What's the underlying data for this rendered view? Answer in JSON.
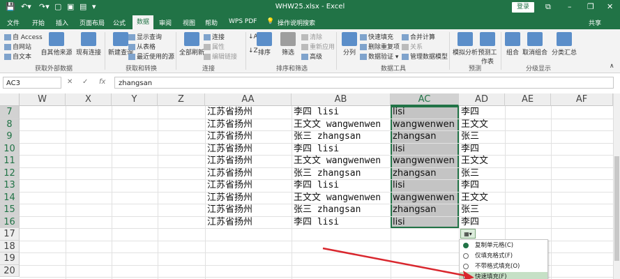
{
  "titlebar": {
    "filename": "WHW25.xlsx  -  Excel",
    "login": "登录",
    "min": "–",
    "restore": "❐",
    "close": "✕",
    "ribbon_display": "⧉"
  },
  "menu": {
    "tabs": [
      "文件",
      "开始",
      "插入",
      "页面布局",
      "公式",
      "数据",
      "审阅",
      "视图",
      "帮助",
      "WPS PDF",
      "操作说明搜索"
    ],
    "share": "共享",
    "active": "数据"
  },
  "ribbon": {
    "get_external": {
      "from_access": "自 Access",
      "from_web": "自网站",
      "from_text": "自文本",
      "from_other": "自其他来源",
      "existing": "现有连接",
      "group": "获取外部数据"
    },
    "get_transform": {
      "new_query": "新建查询",
      "show_queries": "显示查询",
      "from_table": "从表格",
      "recent_sources": "最近使用的源",
      "group": "获取和转换"
    },
    "connections": {
      "refresh_all": "全部刷新",
      "connections": "连接",
      "properties": "属性",
      "edit_links": "编辑链接",
      "group": "连接"
    },
    "sort_filter": {
      "sort": "排序",
      "filter": "筛选",
      "clear": "清除",
      "reapply": "重新应用",
      "advanced": "高级",
      "group": "排序和筛选"
    },
    "data_tools": {
      "text_to_columns": "分列",
      "flash_fill": "快速填充",
      "remove_duplicates": "删除重复项",
      "data_validation": "数据验证",
      "consolidate": "合并计算",
      "relationships": "关系",
      "manage_model": "管理数据模型",
      "group": "数据工具"
    },
    "forecast": {
      "what_if": "模拟分析",
      "forecast_sheet": "预测工作表",
      "group": "预测"
    },
    "outline": {
      "group_btn": "组合",
      "ungroup": "取消组合",
      "subtotal": "分类汇总",
      "group": "分级显示"
    }
  },
  "formula_bar": {
    "name_box": "AC3",
    "cancel": "✕",
    "enter": "✓",
    "fx": "fx",
    "value": "zhangsan"
  },
  "columns": [
    "W",
    "X",
    "Y",
    "Z",
    "AA",
    "AB",
    "AC",
    "AD",
    "AE",
    "AF"
  ],
  "selected_column": "AC",
  "rows": [
    {
      "num": "7",
      "aa": "江苏省扬州",
      "ab": "李四 lisi",
      "ac": "lisi",
      "ad": "李四"
    },
    {
      "num": "8",
      "aa": "江苏省扬州",
      "ab": "王文文 wangwenwen",
      "ac": "wangwenwen",
      "ad": "王文文"
    },
    {
      "num": "9",
      "aa": "江苏省扬州",
      "ab": "张三 zhangsan",
      "ac": "zhangsan",
      "ad": "张三"
    },
    {
      "num": "10",
      "aa": "江苏省扬州",
      "ab": "李四 lisi",
      "ac": "lisi",
      "ad": "李四"
    },
    {
      "num": "11",
      "aa": "江苏省扬州",
      "ab": "王文文 wangwenwen",
      "ac": "wangwenwen",
      "ad": "王文文"
    },
    {
      "num": "12",
      "aa": "江苏省扬州",
      "ab": "张三 zhangsan",
      "ac": "zhangsan",
      "ad": "张三"
    },
    {
      "num": "13",
      "aa": "江苏省扬州",
      "ab": "李四 lisi",
      "ac": "lisi",
      "ad": "李四"
    },
    {
      "num": "14",
      "aa": "江苏省扬州",
      "ab": "王文文 wangwenwen",
      "ac": "wangwenwen",
      "ad": "王文文"
    },
    {
      "num": "15",
      "aa": "江苏省扬州",
      "ab": "张三 zhangsan",
      "ac": "zhangsan",
      "ad": "张三"
    },
    {
      "num": "16",
      "aa": "江苏省扬州",
      "ab": "李四 lisi",
      "ac": "lisi",
      "ad": "李四"
    },
    {
      "num": "17",
      "aa": "",
      "ab": "",
      "ac": "",
      "ad": ""
    },
    {
      "num": "18",
      "aa": "",
      "ab": "",
      "ac": "",
      "ad": ""
    },
    {
      "num": "19",
      "aa": "",
      "ab": "",
      "ac": "",
      "ad": ""
    },
    {
      "num": "20",
      "aa": "",
      "ab": "",
      "ac": "",
      "ad": ""
    }
  ],
  "autofill_menu": {
    "button": "▦▾",
    "options": [
      {
        "label": "复制单元格(C)",
        "checked": true
      },
      {
        "label": "仅填充格式(F)",
        "checked": false
      },
      {
        "label": "不带格式填充(O)",
        "checked": false
      },
      {
        "label": "快速填充(F)",
        "checked": false
      }
    ]
  },
  "colors": {
    "accent": "#217346",
    "arrow": "#d9272e",
    "selection": "#c4c4c4"
  }
}
